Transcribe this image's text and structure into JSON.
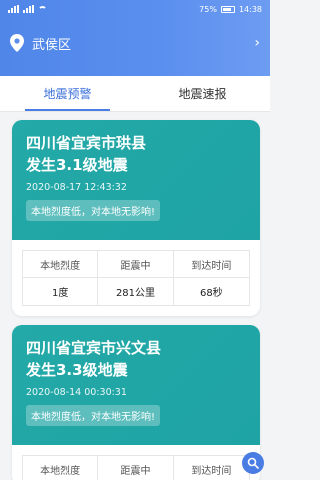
{
  "status_bar": {
    "battery": "75%",
    "time": "14:38"
  },
  "location": {
    "name": "武侯区",
    "arrow": "›"
  },
  "tabs": [
    {
      "label": "地震预警",
      "active": true
    },
    {
      "label": "地震速报",
      "active": false
    }
  ],
  "cards": [
    {
      "title_line1": "四川省宜宾市珙县",
      "title_line2": "发生3.1级地震",
      "time": "2020-08-17 12:43:32",
      "tip": "本地烈度低，对本地无影响!",
      "headers": [
        "本地烈度",
        "距震中",
        "到达时间"
      ],
      "values": [
        "1度",
        "281公里",
        "68秒"
      ]
    },
    {
      "title_line1": "四川省宜宾市兴文县",
      "title_line2": "发生3.3级地震",
      "time": "2020-08-14 00:30:31",
      "tip": "本地烈度低，对本地无影响!",
      "headers": [
        "本地烈度",
        "距震中",
        "到达时间"
      ]
    }
  ],
  "colors": {
    "header": "#5b8fef",
    "card": "#22a7a6",
    "accent": "#3a6fd8"
  }
}
